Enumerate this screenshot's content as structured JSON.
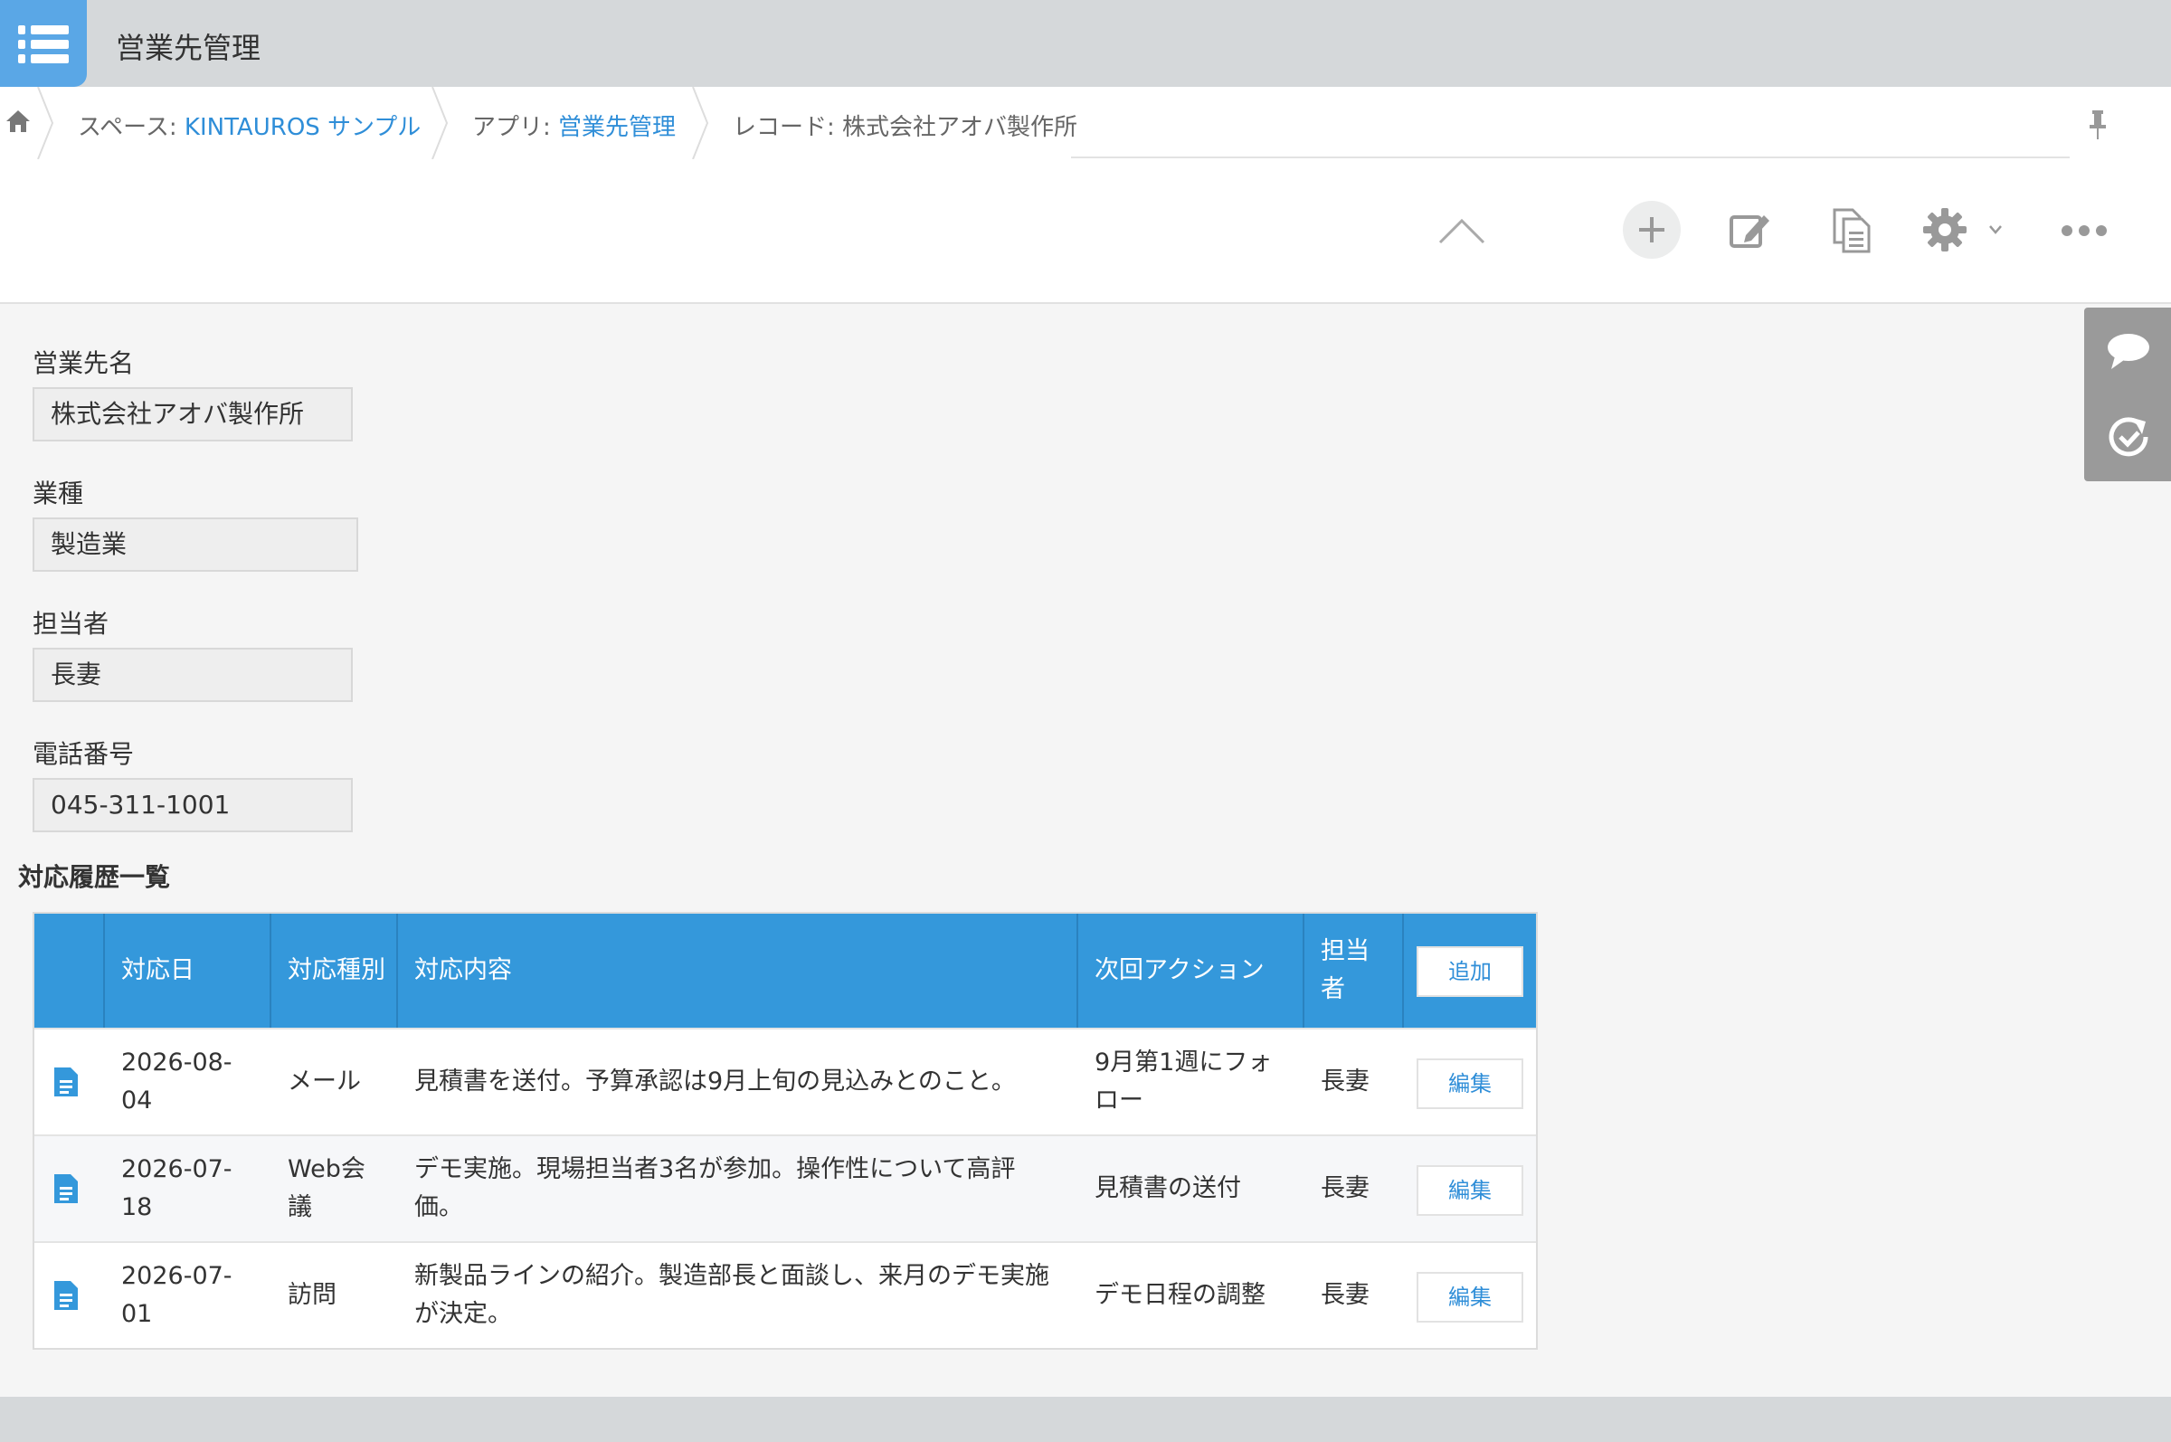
{
  "app": {
    "title": "営業先管理"
  },
  "breadcrumb": {
    "space_prefix": "スペース: ",
    "space_name": "KINTAUROS サンプル",
    "app_prefix": "アプリ: ",
    "app_name": "営業先管理",
    "record_text": "レコード: 株式会社アオバ製作所"
  },
  "toolbar": {
    "icons": [
      "collapse-up-icon",
      "add-record-icon",
      "edit-record-icon",
      "duplicate-record-icon",
      "settings-icon",
      "more-icon"
    ]
  },
  "side_tabs": [
    "comment-icon",
    "history-icon"
  ],
  "fields": [
    {
      "label": "営業先名",
      "value": "株式会社アオバ製作所"
    },
    {
      "label": "業種",
      "value": "製造業"
    },
    {
      "label": "担当者",
      "value": "長妻"
    },
    {
      "label": "電話番号",
      "value": "045-311-1001"
    }
  ],
  "history": {
    "title": "対応履歴一覧",
    "headers": [
      "対応日",
      "対応種別",
      "対応内容",
      "次回アクション",
      "担当者"
    ],
    "add_label": "追加",
    "edit_label": "編集",
    "rows": [
      {
        "date": "2026-08-04",
        "type": "メール",
        "content": "見積書を送付。予算承認は9月上旬の見込みとのこと。",
        "next": "9月第1週にフォロー",
        "owner": "長妻"
      },
      {
        "date": "2026-07-18",
        "type": "Web会議",
        "content": "デモ実施。現場担当者3名が参加。操作性について高評価。",
        "next": "見積書の送付",
        "owner": "長妻"
      },
      {
        "date": "2026-07-01",
        "type": "訪問",
        "content": "新製品ラインの紹介。製造部長と面談し、来月のデモ実施が決定。",
        "next": "デモ日程の調整",
        "owner": "長妻"
      }
    ]
  },
  "colors": {
    "accent": "#3498db",
    "link": "#2f8ed8",
    "header_bg": "#d5d8da"
  }
}
